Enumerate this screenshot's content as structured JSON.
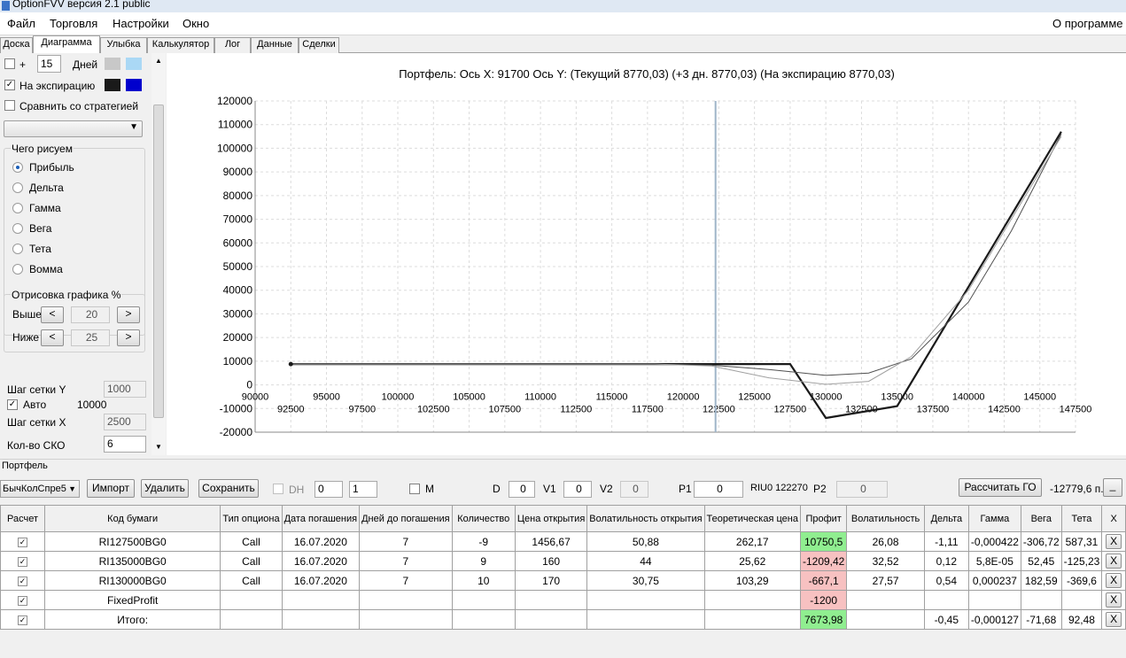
{
  "window": {
    "title": "OptionFVV версия 2.1 public"
  },
  "menu": {
    "items": [
      "Файл",
      "Торговля",
      "Настройки",
      "Окно"
    ],
    "about": "О программе"
  },
  "tabs": [
    "Доска",
    "Диаграмма",
    "Улыбка",
    "Калькулятор",
    "Лог",
    "Данные",
    "Сделки"
  ],
  "left": {
    "plus_label": "+",
    "days_value": "15",
    "days_label": "Дней",
    "expiry_label": "На экспирацию",
    "compare_label": "Сравнить со стратегией",
    "draw_group": "Чего рисуем",
    "radios": [
      "Прибыль",
      "Дельта",
      "Гамма",
      "Вега",
      "Тета",
      "Вомма"
    ],
    "render_group": "Отрисовка графика %",
    "above_label": "Выше",
    "above_value": "20",
    "below_label": "Ниже",
    "below_value": "25",
    "btn_left": "<",
    "btn_right": ">",
    "grid_y_label": "Шаг сетки Y",
    "grid_y_value": "1000",
    "auto_label": "Авто",
    "auto_value": "10000",
    "grid_x_label": "Шаг сетки X",
    "grid_x_value": "2500",
    "sko_label": "Кол-во СКО",
    "sko_value": "6"
  },
  "chart_data": {
    "type": "line",
    "title": "Портфель: Ось X: 91700 Ось Y:  (Текущий 8770,03)  (+3 дн. 8770,03)  (На экспирацию 8770,03)",
    "xlim": [
      90000,
      147500
    ],
    "ylim": [
      -20000,
      120000
    ],
    "x_ticks_top": [
      "90000",
      "95000",
      "100000",
      "105000",
      "110000",
      "115000",
      "120000",
      "125000",
      "130000",
      "135000",
      "140000",
      "145000"
    ],
    "x_ticks_bottom": [
      "92500",
      "97500",
      "102500",
      "107500",
      "112500",
      "117500",
      "122500",
      "127500",
      "132500",
      "137500",
      "142500",
      "147500"
    ],
    "y_ticks": [
      "120000",
      "110000",
      "100000",
      "90000",
      "80000",
      "70000",
      "60000",
      "50000",
      "40000",
      "30000",
      "20000",
      "10000",
      "0",
      "-10000",
      "-20000"
    ],
    "cursor_x": 122270,
    "series": [
      {
        "values": [
          [
            92500,
            8770
          ],
          [
            127500,
            8770
          ],
          [
            130000,
            -14000
          ],
          [
            135000,
            -9000
          ],
          [
            146500,
            107000
          ]
        ]
      },
      {
        "values": [
          [
            92500,
            8770
          ],
          [
            118000,
            8770
          ],
          [
            122000,
            8300
          ],
          [
            126000,
            6500
          ],
          [
            130000,
            4000
          ],
          [
            133000,
            5000
          ],
          [
            136000,
            11000
          ],
          [
            140000,
            35000
          ],
          [
            143000,
            65000
          ],
          [
            146500,
            106000
          ]
        ]
      },
      {
        "values": [
          [
            92500,
            8770
          ],
          [
            118000,
            8770
          ],
          [
            122000,
            8000
          ],
          [
            126000,
            3000
          ],
          [
            130000,
            200
          ],
          [
            133000,
            1500
          ],
          [
            136000,
            12000
          ],
          [
            140000,
            40000
          ],
          [
            143000,
            70000
          ],
          [
            146500,
            105000
          ]
        ]
      }
    ]
  },
  "portfolio": {
    "section_label": "Портфель",
    "strategy": "БычКолСпре5",
    "import": "Импорт",
    "delete": "Удалить",
    "save": "Сохранить",
    "dh_label": "DH",
    "dh_a": "0",
    "dh_b": "1",
    "m_label": "M",
    "d_label": "D",
    "d_value": "0",
    "v1_label": "V1",
    "v1_value": "0",
    "v2_label": "V2",
    "v2_value": "0",
    "p1_label": "P1",
    "p1_value": "0",
    "riu_label": "RIU0 122270",
    "p2_label": "P2",
    "p2_value": "0",
    "calc_go": "Рассчитать ГО",
    "go_value": "-12779,6 п.",
    "min_btn": "_"
  },
  "table": {
    "headers": [
      "Расчет",
      "Код бумаги",
      "Тип опциона",
      "Дата погашения",
      "Дней до погашения",
      "Количество",
      "Цена открытия",
      "Волатильность открытия",
      "Теоретическая цена",
      "Профит",
      "Волатильность",
      "Дельта",
      "Гамма",
      "Вега",
      "Тета",
      "X"
    ],
    "rows": [
      [
        "RI127500BG0",
        "Call",
        "16.07.2020",
        "7",
        "-9",
        "1456,67",
        "50,88",
        "262,17",
        "10750,5",
        "26,08",
        "-1,11",
        "-0,000422",
        "-306,72",
        "587,31"
      ],
      [
        "RI135000BG0",
        "Call",
        "16.07.2020",
        "7",
        "9",
        "160",
        "44",
        "25,62",
        "-1209,42",
        "32,52",
        "0,12",
        "5,8E-05",
        "52,45",
        "-125,23"
      ],
      [
        "RI130000BG0",
        "Call",
        "16.07.2020",
        "7",
        "10",
        "170",
        "30,75",
        "103,29",
        "-667,1",
        "27,57",
        "0,54",
        "0,000237",
        "182,59",
        "-369,6"
      ],
      [
        "FixedProfit",
        "",
        "",
        "",
        "",
        "",
        "",
        "",
        "-1200",
        "",
        "",
        "",
        "",
        ""
      ],
      [
        "Итого:",
        "",
        "",
        "",
        "",
        "",
        "",
        "",
        "7673,98",
        "",
        "-0,45",
        "-0,000127",
        "-71,68",
        "92,48"
      ]
    ],
    "x_label": "X"
  }
}
